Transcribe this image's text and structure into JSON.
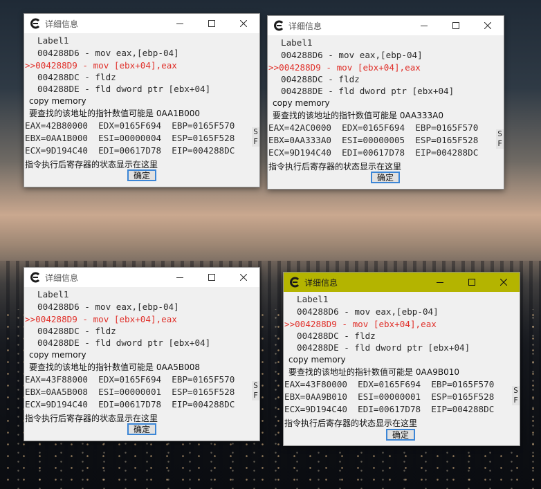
{
  "desktop": {
    "wallpaper": "city skyline at sunset"
  },
  "window_controls": {
    "min": "—",
    "max": "☐",
    "close": "✕"
  },
  "dialogs": [
    {
      "title": "详细信息",
      "code_lines": [
        "Label1",
        "004288D6 - mov eax,[ebp-04]",
        ">>004288D9 - mov [ebx+04],eax",
        "004288DC - fldz",
        "004288DE - fld dword ptr [ebx+04]"
      ],
      "copy_memory": "copy memory",
      "pointer_hint": "要查找的该地址的指针数值可能是 0AA1B000",
      "registers": [
        "EAX=42B80000  EDX=0165F694  EBP=0165F570",
        "EBX=0AA1B000  ESI=00000004  ESP=0165F528",
        "ECX=9D194C40  EDI=00617D78  EIP=004288DC"
      ],
      "side_s": "S",
      "side_f": "F",
      "status": "指令执行后寄存器的状态显示在这里",
      "ok": "确定"
    },
    {
      "title": "详细信息",
      "code_lines": [
        "Label1",
        "004288D6 - mov eax,[ebp-04]",
        ">>004288D9 - mov [ebx+04],eax",
        "004288DC - fldz",
        "004288DE - fld dword ptr [ebx+04]"
      ],
      "copy_memory": "copy memory",
      "pointer_hint": "要查找的该地址的指针数值可能是 0AA333A0",
      "registers": [
        "EAX=42AC0000  EDX=0165F694  EBP=0165F570",
        "EBX=0AA333A0  ESI=00000005  ESP=0165F528",
        "ECX=9D194C40  EDI=00617D78  EIP=004288DC"
      ],
      "side_s": "S",
      "side_f": "F",
      "status": "指令执行后寄存器的状态显示在这里",
      "ok": "确定"
    },
    {
      "title": "详细信息",
      "code_lines": [
        "Label1",
        "004288D6 - mov eax,[ebp-04]",
        ">>004288D9 - mov [ebx+04],eax",
        "004288DC - fldz",
        "004288DE - fld dword ptr [ebx+04]"
      ],
      "copy_memory": "copy memory",
      "pointer_hint": "要查找的该地址的指针数值可能是 0AA5B008",
      "registers": [
        "EAX=43F88000  EDX=0165F694  EBP=0165F570",
        "EBX=0AA5B008  ESI=00000001  ESP=0165F528",
        "ECX=9D194C40  EDI=00617D78  EIP=004288DC"
      ],
      "side_s": "S",
      "side_f": "F",
      "status": "指令执行后寄存器的状态显示在这里",
      "ok": "确定"
    },
    {
      "title": "详细信息",
      "code_lines": [
        "Label1",
        "004288D6 - mov eax,[ebp-04]",
        ">>004288D9 - mov [ebx+04],eax",
        "004288DC - fldz",
        "004288DE - fld dword ptr [ebx+04]"
      ],
      "copy_memory": "copy memory",
      "pointer_hint": "要查找的该地址的指针数值可能是 0AA9B010",
      "registers": [
        "EAX=43F80000  EDX=0165F694  EBP=0165F570",
        "EBX=0AA9B010  ESI=00000001  ESP=0165F528",
        "ECX=9D194C40  EDI=00617D78  EIP=004288DC"
      ],
      "side_s": "S",
      "side_f": "F",
      "status": "指令执行后寄存器的状态显示在这里",
      "ok": "确定"
    }
  ],
  "colors": {
    "active_titlebar": "#b4b400",
    "highlight_line": "#e0302a",
    "ok_border": "#3c86d6"
  }
}
